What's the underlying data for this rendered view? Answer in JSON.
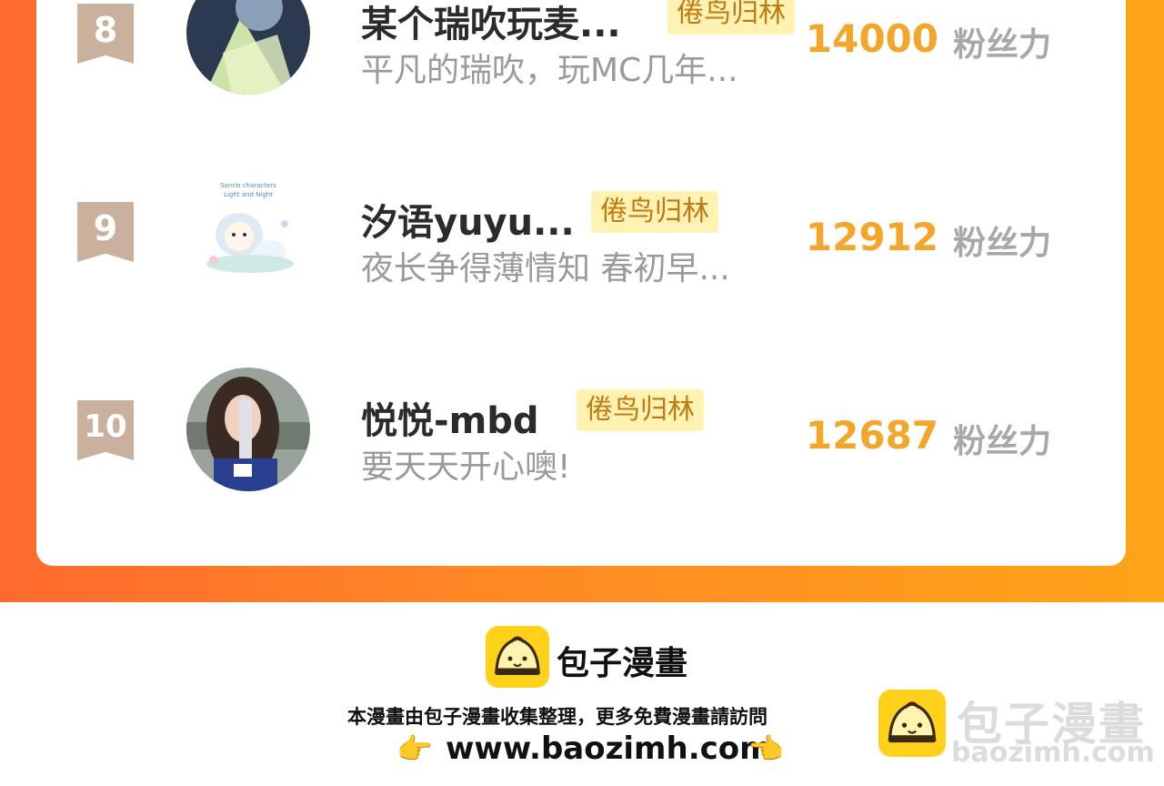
{
  "tag_label": "倦鸟归林",
  "unit_label": "粉丝力",
  "items": [
    {
      "rank": "8",
      "name": "某个瑞吹玩麦...",
      "bio": "平凡的瑞吹，玩MC几年...",
      "fans": "14000"
    },
    {
      "rank": "9",
      "name": "汐语yuyu...",
      "bio": "夜长争得薄情知 春初早...",
      "fans": "12912"
    },
    {
      "rank": "10",
      "name": "悦悦-mbd",
      "bio": "要天天开心噢!",
      "fans": "12687"
    }
  ],
  "footer": {
    "brand": "包子漫畫",
    "desc": "本漫畫由包子漫畫收集整理，更多免費漫畫請訪問",
    "url": "www.baozimh.com",
    "hand_left": "👉",
    "hand_right": "👈"
  },
  "watermark": {
    "brand": "包子漫畫",
    "url": "baozimh.com"
  },
  "colors": {
    "accent": "#ffa418",
    "count": "#f4a62a",
    "tag_bg": "#fff2b3",
    "rank_bg": "#c9b19d"
  }
}
